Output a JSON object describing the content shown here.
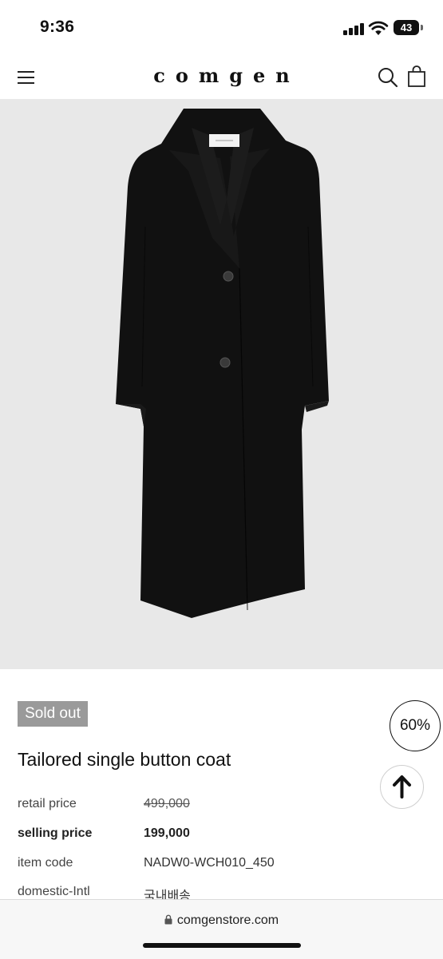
{
  "status_bar": {
    "time": "9:36",
    "battery": "43"
  },
  "header": {
    "logo": "comgen",
    "menu_icon": "menu-icon",
    "search_icon": "search-icon",
    "bag_icon": "shopping-bag-icon"
  },
  "product": {
    "badge": "Sold out",
    "title": "Tailored single button coat",
    "rows": [
      {
        "label": "retail price",
        "value": "499,000"
      },
      {
        "label": "selling price",
        "value": "199,000"
      },
      {
        "label": "item code",
        "value": "NADW0-WCH010_450"
      },
      {
        "label": "domestic-Intl",
        "value": "국내배송"
      }
    ]
  },
  "floating": {
    "zoom": "60%",
    "scroll_top_icon": "arrow-up-icon"
  },
  "browser": {
    "url": "comgenstore.com",
    "lock_icon": "lock-icon"
  },
  "colors": {
    "hero_bg": "#e8e8e8",
    "badge_bg": "#9a9a9a",
    "coat": "#111111"
  }
}
